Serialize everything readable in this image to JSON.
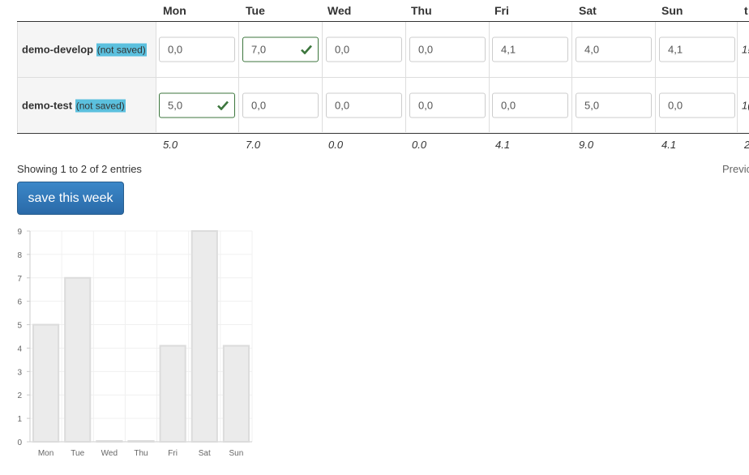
{
  "table": {
    "headers": [
      "Mon",
      "Tue",
      "Wed",
      "Thu",
      "Fri",
      "Sat",
      "Sun",
      "t"
    ],
    "rows": [
      {
        "name": "demo-develop",
        "badge": "(not saved)",
        "values": [
          "0,0",
          "7,0",
          "0,0",
          "0,0",
          "4,1",
          "4,0",
          "4,1"
        ],
        "valid": [
          false,
          true,
          false,
          false,
          false,
          false,
          false
        ],
        "total_partial": "1!"
      },
      {
        "name": "demo-test",
        "badge": "(not saved)",
        "values": [
          "5,0",
          "0,0",
          "0,0",
          "0,0",
          "0,0",
          "5,0",
          "0,0"
        ],
        "valid": [
          true,
          false,
          false,
          false,
          false,
          false,
          false
        ],
        "total_partial": "1("
      }
    ],
    "totals": [
      "5.0",
      "7.0",
      "0.0",
      "0.0",
      "4.1",
      "9.0",
      "4.1",
      "2"
    ]
  },
  "footer": {
    "info": "Showing 1 to 2 of 2 entries",
    "previous_partial": "Previc"
  },
  "actions": {
    "save_label": "save this week"
  },
  "colors": {
    "bar_fill": "#ebebeb",
    "bar_stroke": "#dcdcdc",
    "check_green": "#3c763d",
    "badge_bg": "#5bc0de"
  },
  "chart_data": {
    "type": "bar",
    "categories": [
      "Mon",
      "Tue",
      "Wed",
      "Thu",
      "Fri",
      "Sat",
      "Sun"
    ],
    "values": [
      5,
      7,
      0,
      0,
      4.1,
      9,
      4.1
    ],
    "yticks": [
      0,
      1,
      2,
      3,
      4,
      5,
      6,
      7,
      8,
      9
    ],
    "ylim": [
      0,
      9
    ],
    "grid": true,
    "title": "",
    "xlabel": "",
    "ylabel": ""
  }
}
